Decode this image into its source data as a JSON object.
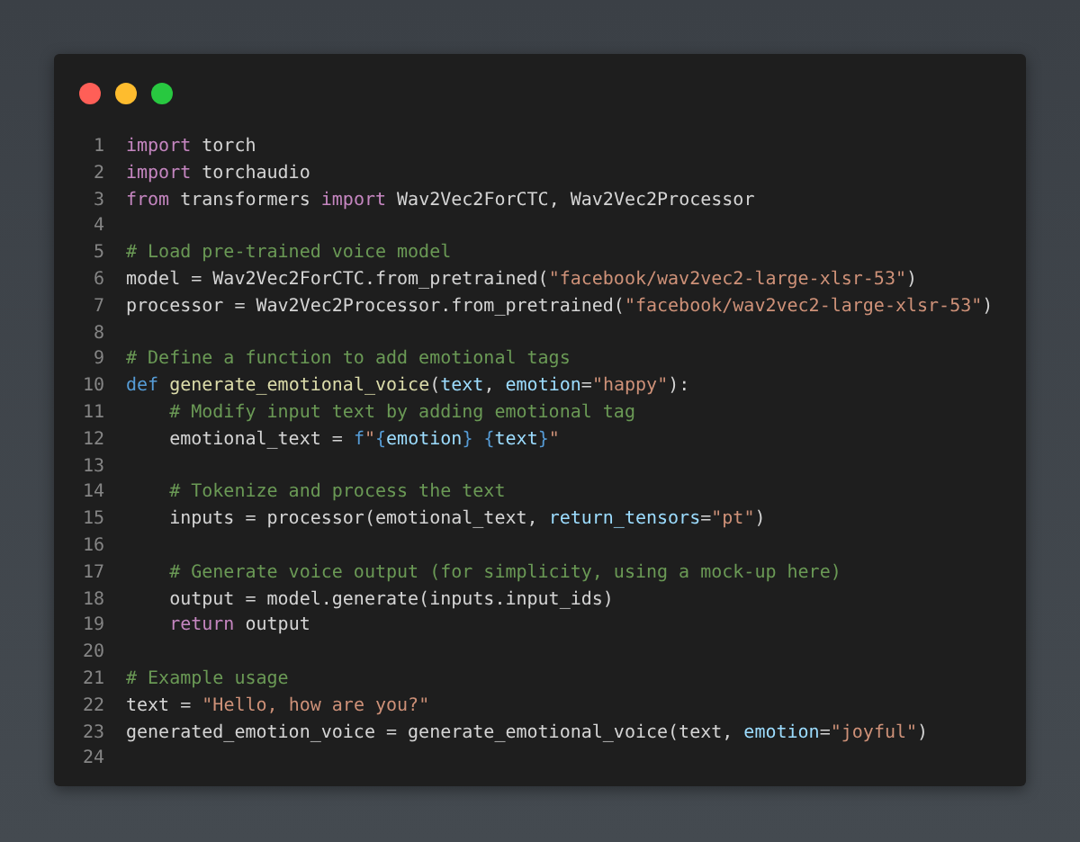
{
  "code_lines": [
    {
      "number": "1",
      "tokens": [
        {
          "text": "import",
          "kind": "keyword"
        },
        {
          "text": " torch",
          "kind": "plain"
        }
      ]
    },
    {
      "number": "2",
      "tokens": [
        {
          "text": "import",
          "kind": "keyword"
        },
        {
          "text": " torchaudio",
          "kind": "plain"
        }
      ]
    },
    {
      "number": "3",
      "tokens": [
        {
          "text": "from",
          "kind": "keyword"
        },
        {
          "text": " transformers ",
          "kind": "plain"
        },
        {
          "text": "import",
          "kind": "keyword"
        },
        {
          "text": " Wav2Vec2ForCTC, Wav2Vec2Processor",
          "kind": "plain"
        }
      ]
    },
    {
      "number": "4"
    },
    {
      "number": "5",
      "tokens": [
        {
          "text": "# Load pre-trained voice model",
          "kind": "comment"
        }
      ]
    },
    {
      "number": "6",
      "tokens": [
        {
          "text": "model = Wav2Vec2ForCTC.from_pretrained(",
          "kind": "plain"
        },
        {
          "text": "\"facebook/wav2vec2-large-xlsr-53\"",
          "kind": "string"
        },
        {
          "text": ")",
          "kind": "plain"
        }
      ]
    },
    {
      "number": "7",
      "tokens": [
        {
          "text": "processor = Wav2Vec2Processor.from_pretrained(",
          "kind": "plain"
        },
        {
          "text": "\"facebook/wav2vec2-large-xlsr-53\"",
          "kind": "string"
        },
        {
          "text": ")",
          "kind": "plain"
        }
      ]
    },
    {
      "number": "8"
    },
    {
      "number": "9",
      "tokens": [
        {
          "text": "# Define a function to add emotional tags",
          "kind": "comment"
        }
      ]
    },
    {
      "number": "10",
      "tokens": [
        {
          "text": "def ",
          "kind": "storage"
        },
        {
          "text": "generate_emotional_voice",
          "kind": "function"
        },
        {
          "text": "(",
          "kind": "plain"
        },
        {
          "text": "text",
          "kind": "param"
        },
        {
          "text": ", ",
          "kind": "plain"
        },
        {
          "text": "emotion",
          "kind": "param"
        },
        {
          "text": "=",
          "kind": "plain"
        },
        {
          "text": "\"happy\"",
          "kind": "string"
        },
        {
          "text": "):",
          "kind": "plain"
        }
      ]
    },
    {
      "number": "11",
      "tokens": [
        {
          "text": "    # Modify input text by adding emotional tag",
          "kind": "comment"
        }
      ]
    },
    {
      "number": "12",
      "tokens": [
        {
          "text": "    emotional_text = ",
          "kind": "plain"
        },
        {
          "text": "f",
          "kind": "storage"
        },
        {
          "text": "\"",
          "kind": "string"
        },
        {
          "text": "{",
          "kind": "storage"
        },
        {
          "text": "emotion",
          "kind": "param"
        },
        {
          "text": "} ",
          "kind": "storage"
        },
        {
          "text": "{",
          "kind": "storage"
        },
        {
          "text": "text",
          "kind": "param"
        },
        {
          "text": "}",
          "kind": "storage"
        },
        {
          "text": "\"",
          "kind": "string"
        }
      ]
    },
    {
      "number": "13"
    },
    {
      "number": "14",
      "tokens": [
        {
          "text": "    # Tokenize and process the text",
          "kind": "comment"
        }
      ]
    },
    {
      "number": "15",
      "tokens": [
        {
          "text": "    inputs = processor(emotional_text, ",
          "kind": "plain"
        },
        {
          "text": "return_tensors",
          "kind": "param"
        },
        {
          "text": "=",
          "kind": "plain"
        },
        {
          "text": "\"pt\"",
          "kind": "string"
        },
        {
          "text": ")",
          "kind": "plain"
        }
      ]
    },
    {
      "number": "16"
    },
    {
      "number": "17",
      "tokens": [
        {
          "text": "    # Generate voice output (for simplicity, using a mock-up here)",
          "kind": "comment"
        }
      ]
    },
    {
      "number": "18",
      "tokens": [
        {
          "text": "    output = model.generate(inputs.input_ids)",
          "kind": "plain"
        }
      ]
    },
    {
      "number": "19",
      "tokens": [
        {
          "text": "    return",
          "kind": "keyword"
        },
        {
          "text": " output",
          "kind": "plain"
        }
      ]
    },
    {
      "number": "20"
    },
    {
      "number": "21",
      "tokens": [
        {
          "text": "# Example usage",
          "kind": "comment"
        }
      ]
    },
    {
      "number": "22",
      "tokens": [
        {
          "text": "text = ",
          "kind": "plain"
        },
        {
          "text": "\"Hello, how are you?\"",
          "kind": "string"
        }
      ]
    },
    {
      "number": "23",
      "tokens": [
        {
          "text": "generated_emotion_voice = generate_emotional_voice(text, ",
          "kind": "plain"
        },
        {
          "text": "emotion",
          "kind": "param"
        },
        {
          "text": "=",
          "kind": "plain"
        },
        {
          "text": "\"joyful\"",
          "kind": "string"
        },
        {
          "text": ")",
          "kind": "plain"
        }
      ]
    },
    {
      "number": "24"
    }
  ]
}
